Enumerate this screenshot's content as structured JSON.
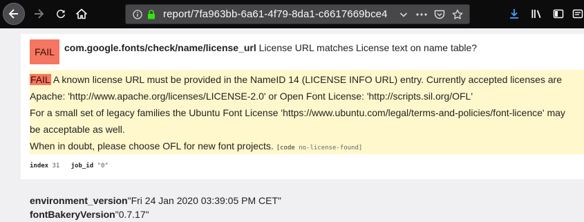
{
  "browser": {
    "url": "report/7fa963bb-6a61-4f79-8da1-c6617669bce4"
  },
  "check": {
    "status": "FAIL",
    "id": "com.google.fonts/check/name/license_url",
    "description": "License URL matches License text on name table?",
    "message": {
      "status": "FAIL",
      "line1": "A known license URL must be provided in the NameID 14 (LICENSE INFO URL) entry. Currently accepted licenses are",
      "line2": "Apache: 'http://www.apache.org/licenses/LICENSE-2.0' or Open Font License: 'http://scripts.sil.org/OFL'",
      "line3": "For a small set of legacy families the Ubuntu Font License 'https://www.ubuntu.com/legal/terms-and-policies/font-licence' may",
      "line4": "be acceptable as well.",
      "line5": "When in doubt, please choose OFL for new font projects.",
      "code_label": "[code",
      "code_value": "no-license-found]"
    },
    "meta": {
      "index_label": "index",
      "index_value": "31",
      "job_label": "job_id",
      "job_value": "\"0\""
    }
  },
  "environment": {
    "env_label": "environment_version",
    "env_value": "\"Fri 24 Jan 2020 03:39:05 PM CET\"",
    "fb_label": "fontBakeryVersion",
    "fb_value": "\"0.7.17\""
  },
  "colors": {
    "fail": "#f57661",
    "message_bg": "#fff8cc",
    "download_accent": "#45a1ff",
    "lock": "#30e60b"
  }
}
